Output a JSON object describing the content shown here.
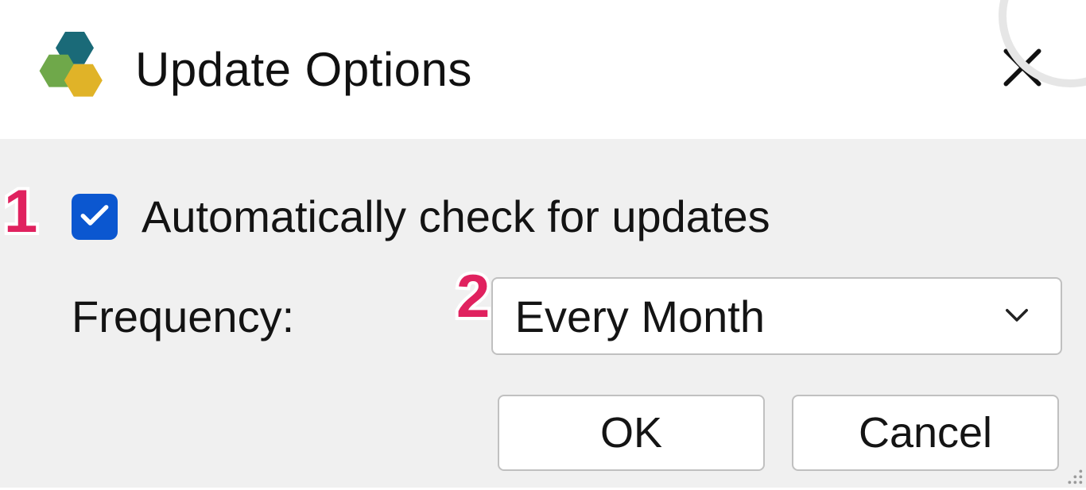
{
  "dialog": {
    "title": "Update Options",
    "checkbox_label": "Automatically check for updates",
    "checkbox_checked": true,
    "frequency_label": "Frequency:",
    "frequency_value": "Every Month",
    "ok_label": "OK",
    "cancel_label": "Cancel"
  },
  "markers": {
    "m1": "1",
    "m2": "2"
  },
  "colors": {
    "accent": "#0b57d0",
    "marker": "#e0225f",
    "hex_green": "#6fa84a",
    "hex_teal": "#1a6a78",
    "hex_yellow": "#e0b328"
  }
}
